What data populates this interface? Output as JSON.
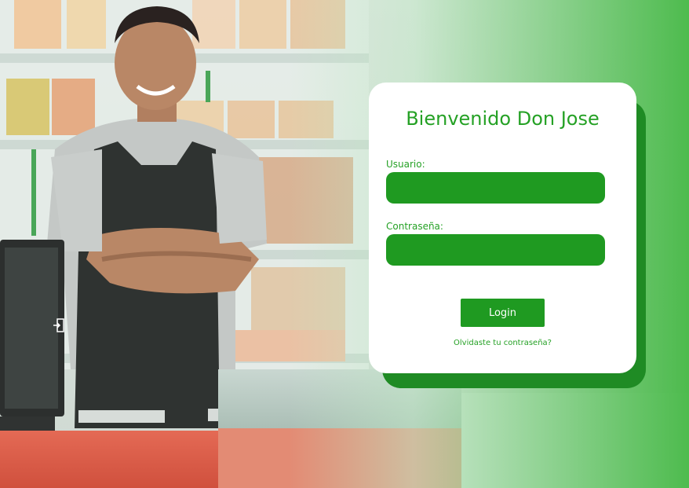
{
  "login": {
    "title": "Bienvenido Don Jose",
    "username_label": "Usuario:",
    "username_value": "",
    "password_label": "Contraseña:",
    "password_value": "",
    "login_button": "Login",
    "forgot_link": "Olvidaste tu contraseña?"
  },
  "colors": {
    "brand_green": "#1f9a21",
    "title_green": "#25a125",
    "card_shadow": "#1f8b24",
    "card_bg": "#ffffff"
  },
  "icons": {
    "side_icon": "exit-icon"
  }
}
